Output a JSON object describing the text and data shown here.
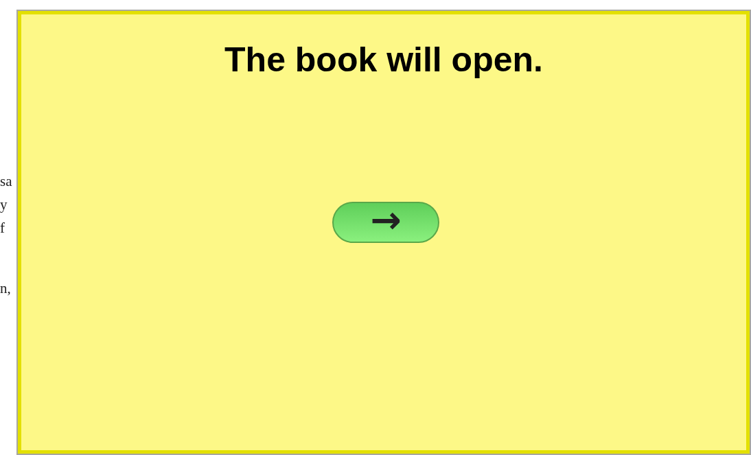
{
  "background_text": [
    "sa",
    "y",
    "f",
    "n,"
  ],
  "dialog": {
    "title": "The book will open.",
    "next_button": {
      "label": "→"
    }
  }
}
